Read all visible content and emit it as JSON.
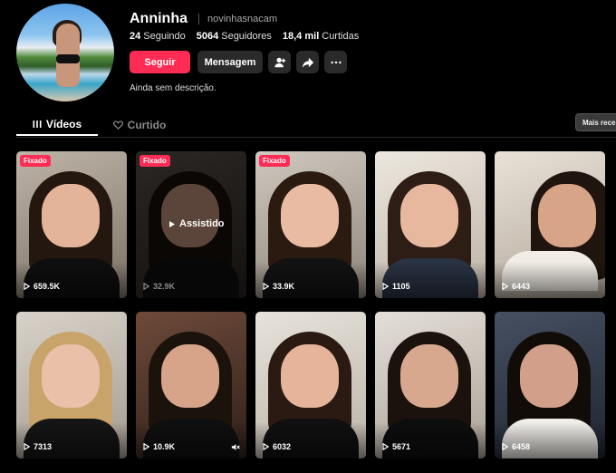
{
  "profile": {
    "display_name": "Anninha",
    "username": "novinhasnacam",
    "bio": "Ainda sem descrição."
  },
  "stats": {
    "following": {
      "value": "24",
      "label": "Seguindo"
    },
    "followers": {
      "value": "5064",
      "label": "Seguidores"
    },
    "likes": {
      "value": "18,4 mil",
      "label": "Curtidas"
    }
  },
  "actions": {
    "follow_label": "Seguir",
    "message_label": "Mensagem"
  },
  "tabs": [
    {
      "label": "Vídeos",
      "icon": "grid-lines-icon"
    },
    {
      "label": "Curtido",
      "icon": "heart-outline-icon"
    }
  ],
  "sort_chip": "Mais recentes",
  "colors": {
    "accent": "#fe2c55",
    "background": "#000000",
    "button_dark": "#2a2a2a"
  },
  "videos": [
    {
      "views": "659.5K",
      "pinned_label": "Fixado"
    },
    {
      "views": "32.9K",
      "pinned_label": "Fixado",
      "watched_label": "Assistido"
    },
    {
      "views": "33.9K",
      "pinned_label": "Fixado"
    },
    {
      "views": "1105"
    },
    {
      "views": "6443"
    },
    {
      "views": "7313"
    },
    {
      "views": "10.9K",
      "muted": true
    },
    {
      "views": "6032"
    },
    {
      "views": "5671"
    },
    {
      "views": "6458"
    }
  ]
}
